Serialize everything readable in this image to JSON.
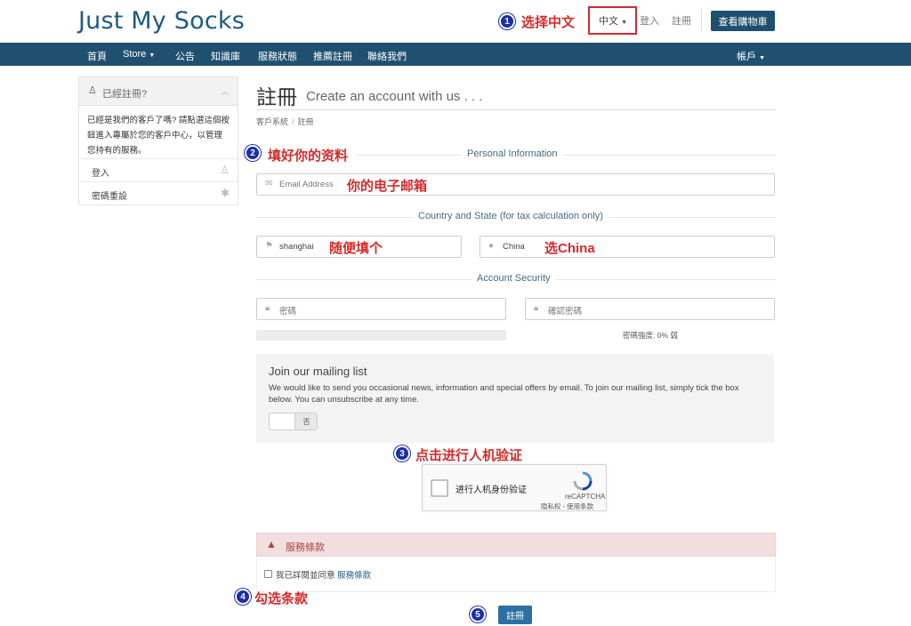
{
  "header": {
    "brand": "Just My Socks",
    "language": "中文",
    "login": "登入",
    "register": "註冊",
    "cart": "查看購物車"
  },
  "nav": {
    "items": [
      "首頁",
      "Store",
      "公告",
      "知識庫",
      "服務狀態",
      "推薦註冊",
      "聯絡我們"
    ],
    "account": "帳戶"
  },
  "annotations": {
    "step1": {
      "num": "1",
      "text": "选择中文"
    },
    "step2": {
      "num": "2",
      "text": "填好你的资料"
    },
    "email_hint": "你的电子邮箱",
    "city_hint": "随便填个",
    "country_hint": "选China",
    "step3": {
      "num": "3",
      "text": "点击进行人机验证"
    },
    "step4": {
      "num": "4",
      "text": "勾选条款"
    },
    "step5": {
      "num": "5"
    }
  },
  "sidebar": {
    "title": "已經註冊?",
    "text": "已經是我們的客戶了嗎? 請點選這個按鈕進入專屬於您的客戶中心，以管理您持有的服務。",
    "items": [
      {
        "label": "登入",
        "icon": "user-icon"
      },
      {
        "label": "密碼重設",
        "icon": "asterisk-icon"
      }
    ]
  },
  "page": {
    "title": "註冊",
    "subtitle": "Create an account with us . . .",
    "breadcrumb": [
      "客戶系統",
      "註冊"
    ]
  },
  "form": {
    "personal_info_label": "Personal Information",
    "email_placeholder": "Email Address",
    "country_state_label": "Country and State (for tax calculation only)",
    "city_value": "shanghai",
    "country_value": "China",
    "account_security_label": "Account Security",
    "password_placeholder": "密碼",
    "confirm_password_placeholder": "確認密碼",
    "strength_text": "密碼強度: 0% 弱",
    "strength_percent": 0
  },
  "mailing": {
    "title": "Join our mailing list",
    "description": "We would like to send you occasional news, information and special offers by email. To join our mailing list, simply tick the box below. You can unsubscribe at any time.",
    "toggle_label": "否"
  },
  "captcha": {
    "label": "进行人机身份验证",
    "brand": "reCAPTCHA",
    "links": "隐私权 - 使用条款"
  },
  "terms": {
    "title": "服務條款",
    "checkbox_text": "我已詳閱並同意",
    "link_text": "服務條款"
  },
  "submit": {
    "label": "註冊"
  },
  "colors": {
    "brand": "#1e5a85",
    "navbar": "#1f5070",
    "annotation": "#d62a2a",
    "marker": "#1a2fa8",
    "alert_bg": "#f2dede"
  }
}
